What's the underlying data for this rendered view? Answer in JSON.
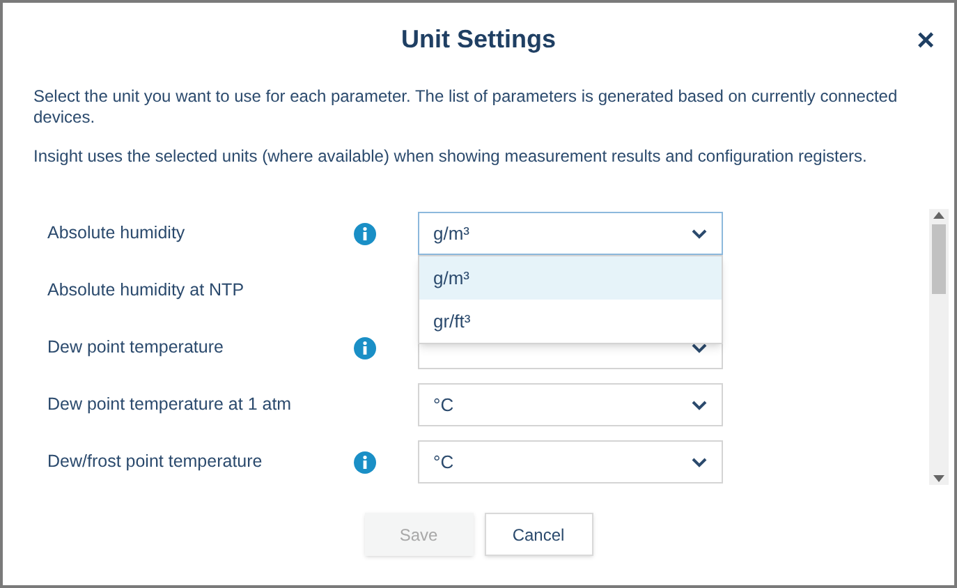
{
  "dialog": {
    "title": "Unit Settings",
    "close": "×"
  },
  "intro": [
    "Select the unit you want to use for each parameter. The list of parameters is generated based on currently connected devices.",
    "Insight uses the selected units (where available) when showing measurement results and configuration registers."
  ],
  "parameters": [
    {
      "label": "Absolute humidity",
      "info": true,
      "value": "g/m³",
      "expanded": true,
      "options": [
        {
          "label": "g/m³",
          "selected": true
        },
        {
          "label": "gr/ft³",
          "selected": false
        }
      ]
    },
    {
      "label": "Absolute humidity at NTP",
      "info": false
    },
    {
      "label": "Dew point temperature",
      "info": true,
      "expanded": false
    },
    {
      "label": "Dew point temperature at 1 atm",
      "info": false,
      "value": "°C",
      "expanded": false
    },
    {
      "label": "Dew/frost point temperature",
      "info": true,
      "value": "°C",
      "expanded": false
    }
  ],
  "buttons": [
    {
      "label": "Save",
      "disabled": true
    },
    {
      "label": "Cancel",
      "disabled": false
    }
  ]
}
